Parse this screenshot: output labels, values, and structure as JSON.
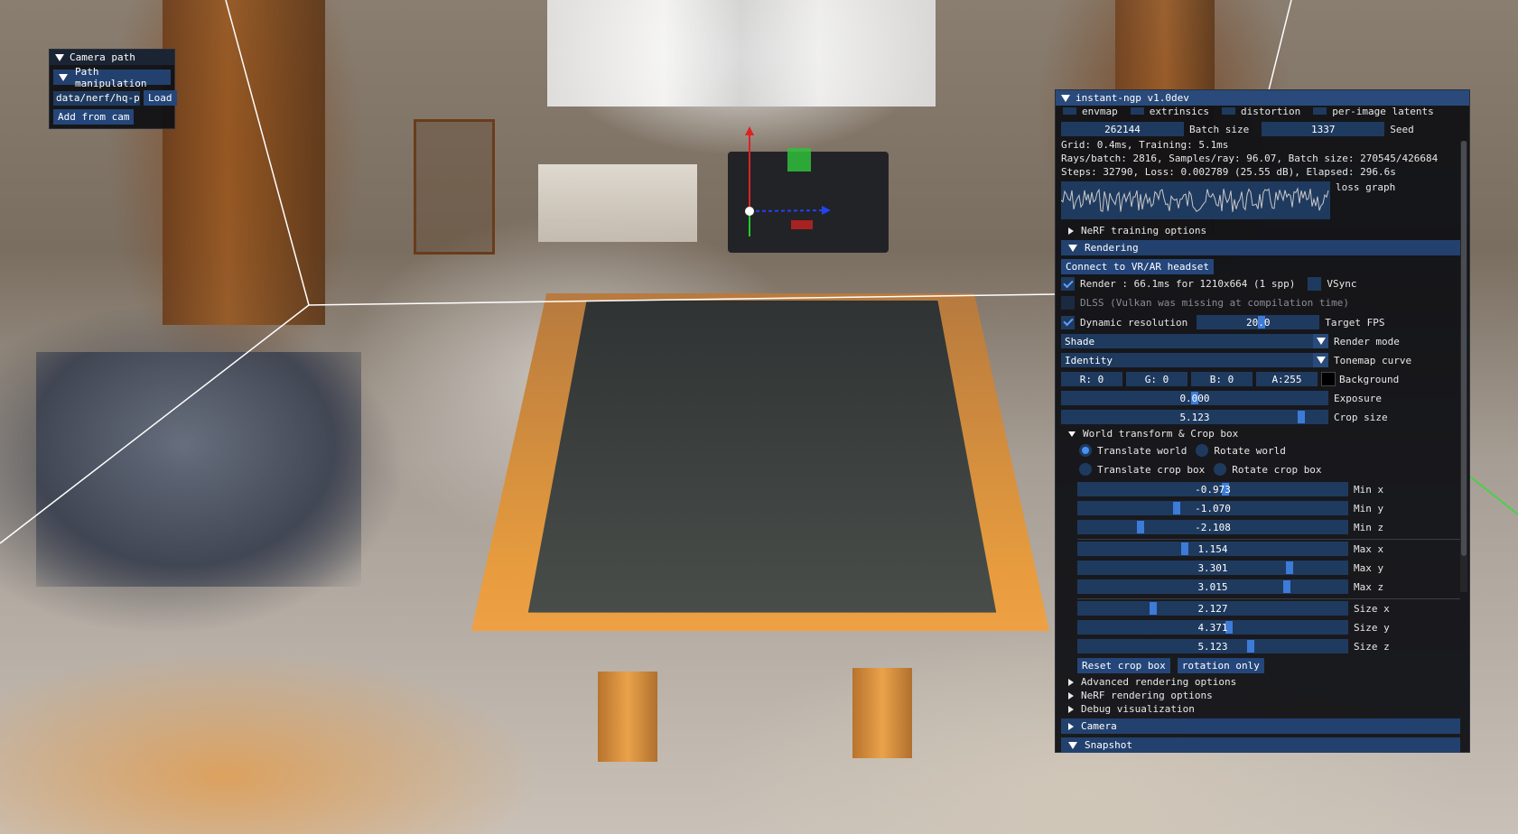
{
  "camera_path": {
    "title": "Camera path",
    "path_header": "Path manipulation",
    "path_value": "data/nerf/hq-p",
    "load_label": "Load",
    "add_label": "Add from cam"
  },
  "ngp": {
    "title": "instant-ngp v1.0dev",
    "checkboxes_top": [
      "envmap",
      "extrinsics",
      "distortion",
      "per-image latents"
    ],
    "batch_size_value": "262144",
    "batch_size_label": "Batch size",
    "seed_value": "1337",
    "seed_label": "Seed",
    "stats1": "Grid: 0.4ms, Training: 5.1ms",
    "stats2": "Rays/batch: 2816, Samples/ray: 96.07, Batch size: 270545/426684",
    "stats3": "Steps: 32790, Loss: 0.002789 (25.55 dB), Elapsed: 296.6s",
    "loss_graph_label": "loss graph",
    "nerf_training": "NeRF training options",
    "rendering": "Rendering",
    "vr_button": "Connect to VR/AR headset",
    "render_label": "Render : 66.1ms for 1210x664 (1 spp)",
    "vsync_label": "VSync",
    "dlss_label": "DLSS (Vulkan was missing at compilation time)",
    "dynres_label": "Dynamic resolution",
    "target_fps_value": "20.0",
    "target_fps_label": "Target FPS",
    "render_mode_value": "Shade",
    "render_mode_label": "Render mode",
    "tonemap_value": "Identity",
    "tonemap_label": "Tonemap curve",
    "bg_r": "R:  0",
    "bg_g": "G:  0",
    "bg_b": "B:  0",
    "bg_a": "A:255",
    "background_label": "Background",
    "exposure_value": "0.000",
    "exposure_label": "Exposure",
    "crop_size_value": "5.123",
    "crop_size_label": "Crop size",
    "world_transform": "World transform & Crop box",
    "translate_world": "Translate world",
    "rotate_world": "Rotate world",
    "translate_crop": "Translate crop box",
    "rotate_crop": "Rotate crop box",
    "min_x_value": "-0.973",
    "min_x_label": "Min x",
    "min_y_value": "-1.070",
    "min_y_label": "Min y",
    "min_z_value": "-2.108",
    "min_z_label": "Min z",
    "max_x_value": "1.154",
    "max_x_label": "Max x",
    "max_y_value": "3.301",
    "max_y_label": "Max y",
    "max_z_value": "3.015",
    "max_z_label": "Max z",
    "size_x_value": "2.127",
    "size_x_label": "Size x",
    "size_y_value": "4.371",
    "size_y_label": "Size y",
    "size_z_value": "5.123",
    "size_z_label": "Size z",
    "reset_crop": "Reset crop box",
    "rotation_only": "rotation only",
    "advanced_rendering": "Advanced rendering options",
    "nerf_rendering": "NeRF rendering options",
    "debug_vis": "Debug visualization",
    "camera": "Camera",
    "snapshot": "Snapshot"
  },
  "colors": {
    "title_bar": "#294a7a",
    "frame_bg": "#1f3a5f",
    "accent": "#3d7bd8"
  }
}
